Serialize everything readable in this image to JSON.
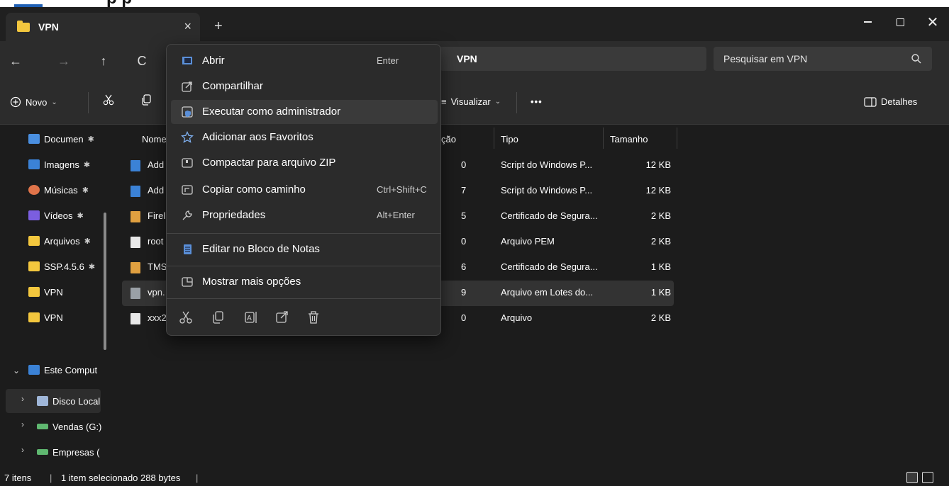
{
  "window": {
    "tab_title": "VPN",
    "close_tab": "×",
    "new_tab": "+",
    "minimize": "—",
    "maximize": "☐",
    "close": "✕"
  },
  "nav": {
    "back": "←",
    "forward": "→",
    "up": "↑",
    "refresh": "C"
  },
  "address": {
    "path": "VPN"
  },
  "search": {
    "placeholder": "Pesquisar em VPN"
  },
  "toolbar": {
    "new_label": "Novo",
    "view_label": "Visualizar",
    "more_label": "•••",
    "details_label": "Detalhes"
  },
  "sidebar": {
    "quick_access": [
      {
        "label": "Documen",
        "pin": "✱",
        "color": "#4a8fe0"
      },
      {
        "label": "Imagens",
        "pin": "✱",
        "color": "#3b82d6"
      },
      {
        "label": "Músicas",
        "pin": "✱",
        "color": "#e0744a"
      },
      {
        "label": "Vídeos",
        "pin": "✱",
        "color": "#7b5ee0"
      },
      {
        "label": "Arquivos",
        "pin": "✱",
        "color": "#f3c73e"
      },
      {
        "label": "SSP.4.5.6",
        "pin": "✱",
        "color": "#f3c73e"
      },
      {
        "label": "VPN",
        "pin": "",
        "color": "#f3c73e"
      },
      {
        "label": "VPN",
        "pin": "",
        "color": "#f3c73e"
      }
    ],
    "this_pc": "Este Comput",
    "drives": [
      {
        "label": "Disco Local"
      },
      {
        "label": "Vendas (G:)"
      },
      {
        "label": "Empresas ("
      }
    ]
  },
  "columns": {
    "name": "Nome",
    "date_fragment": "ção",
    "type": "Tipo",
    "size": "Tamanho"
  },
  "files": [
    {
      "name": "Add",
      "date_frag": "0",
      "type": "Script do Windows P...",
      "size": "12 KB",
      "icon_color": "#3b82d6"
    },
    {
      "name": "Add",
      "date_frag": "7",
      "type": "Script do Windows P...",
      "size": "12 KB",
      "icon_color": "#3b82d6"
    },
    {
      "name": "Firel",
      "date_frag": "5",
      "type": "Certificado de Segura...",
      "size": "2 KB",
      "icon_color": "#e0a040"
    },
    {
      "name": "root",
      "date_frag": "0",
      "type": "Arquivo PEM",
      "size": "2 KB",
      "icon_color": "#e8e8e8"
    },
    {
      "name": "TMS",
      "date_frag": "6",
      "type": "Certificado de Segura...",
      "size": "1 KB",
      "icon_color": "#e0a040"
    },
    {
      "name": "vpn.",
      "date_frag": "9",
      "type": "Arquivo em Lotes do...",
      "size": "1 KB",
      "icon_color": "#9aa0a6"
    },
    {
      "name": "xxx2",
      "date_frag": "0",
      "type": "Arquivo",
      "size": "2 KB",
      "icon_color": "#e8e8e8"
    }
  ],
  "context_menu": {
    "items": [
      {
        "label": "Abrir",
        "shortcut": "Enter"
      },
      {
        "label": "Compartilhar",
        "shortcut": ""
      },
      {
        "label": "Executar como administrador",
        "shortcut": ""
      },
      {
        "label": "Adicionar aos Favoritos",
        "shortcut": ""
      },
      {
        "label": "Compactar para arquivo ZIP",
        "shortcut": ""
      },
      {
        "label": "Copiar como caminho",
        "shortcut": "Ctrl+Shift+C"
      },
      {
        "label": "Propriedades",
        "shortcut": "Alt+Enter"
      },
      {
        "label": "Editar no Bloco de Notas",
        "shortcut": ""
      },
      {
        "label": "Mostrar mais opções",
        "shortcut": ""
      }
    ]
  },
  "status": {
    "item_count": "7 itens",
    "selected": "1 item selecionado  288 bytes"
  }
}
